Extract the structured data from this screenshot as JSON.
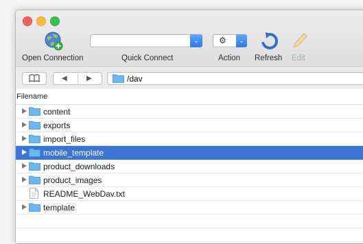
{
  "toolbar": {
    "open_connection_label": "Open Connection",
    "quick_connect_label": "Quick Connect",
    "quick_connect_value": "",
    "action_label": "Action",
    "refresh_label": "Refresh",
    "edit_label": "Edit"
  },
  "navigation": {
    "path": "/dav"
  },
  "browser": {
    "column_filename": "Filename",
    "items": [
      {
        "name": "content",
        "type": "folder",
        "selected": false
      },
      {
        "name": "exports",
        "type": "folder",
        "selected": false
      },
      {
        "name": "import_files",
        "type": "folder",
        "selected": false
      },
      {
        "name": "mobile_template",
        "type": "folder",
        "selected": true
      },
      {
        "name": "product_downloads",
        "type": "folder",
        "selected": false
      },
      {
        "name": "product_images",
        "type": "folder",
        "selected": false
      },
      {
        "name": "README_WebDav.txt",
        "type": "file",
        "selected": false
      },
      {
        "name": "template",
        "type": "folder",
        "selected": false
      }
    ]
  },
  "colors": {
    "selection": "#3875d7",
    "folder": "#6ab8f0",
    "accent": "#2b79f0"
  }
}
